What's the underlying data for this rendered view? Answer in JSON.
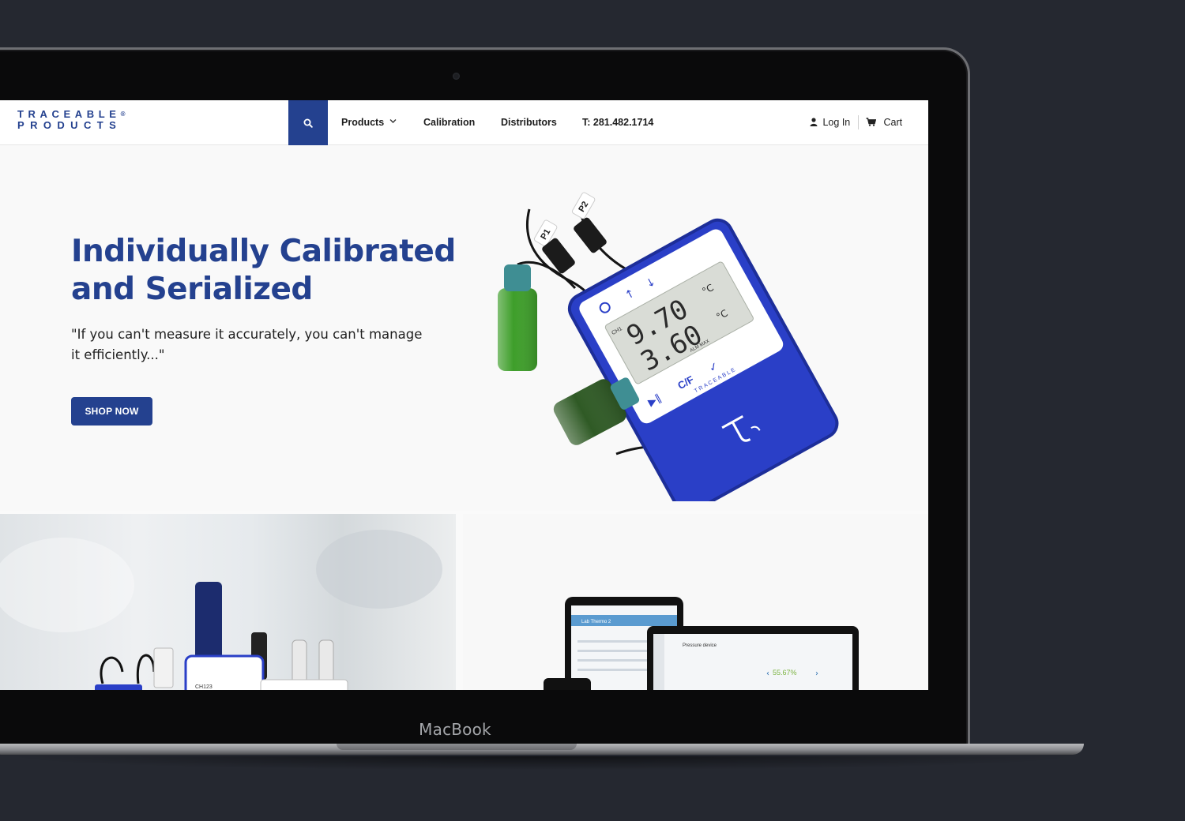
{
  "device": {
    "chin_label": "MacBook"
  },
  "header": {
    "logo": {
      "line1": "TRACEABLE",
      "registered": "®",
      "line2": "PRODUCTS"
    },
    "nav": [
      {
        "label": "Products"
      },
      {
        "label": "Calibration"
      },
      {
        "label": "Distributors"
      },
      {
        "label": "T: 281.482.1714"
      }
    ],
    "login_label": "Log In",
    "cart_label": "Cart"
  },
  "hero": {
    "title_line1": "Individually Calibrated",
    "title_line2": "and Serialized",
    "quote": "\"If you can't measure it accurately, you can't manage it efficiently...\"",
    "cta_label": "SHOP NOW",
    "product_display": {
      "reading_top": "9.70",
      "reading_bottom": "3.60",
      "unit": "°C",
      "channel": "CH1",
      "alm_label": "ALM MAX",
      "toggle_label": "C/F",
      "probe_labels": [
        "P1",
        "P2"
      ],
      "brand": "TRACEABLE"
    }
  },
  "panels": {
    "left": {
      "display_text": "CH123"
    },
    "right": {
      "tablet_title": "Lab Thermo 2",
      "laptop_title": "Pressure device",
      "reading": "55.67%"
    }
  },
  "colors": {
    "brand_blue": "#24418f",
    "device_blue": "#2a3fc7",
    "page_bg": "#252830"
  },
  "icons": [
    "search-icon",
    "chevron-down-icon",
    "user-icon",
    "cart-icon"
  ]
}
